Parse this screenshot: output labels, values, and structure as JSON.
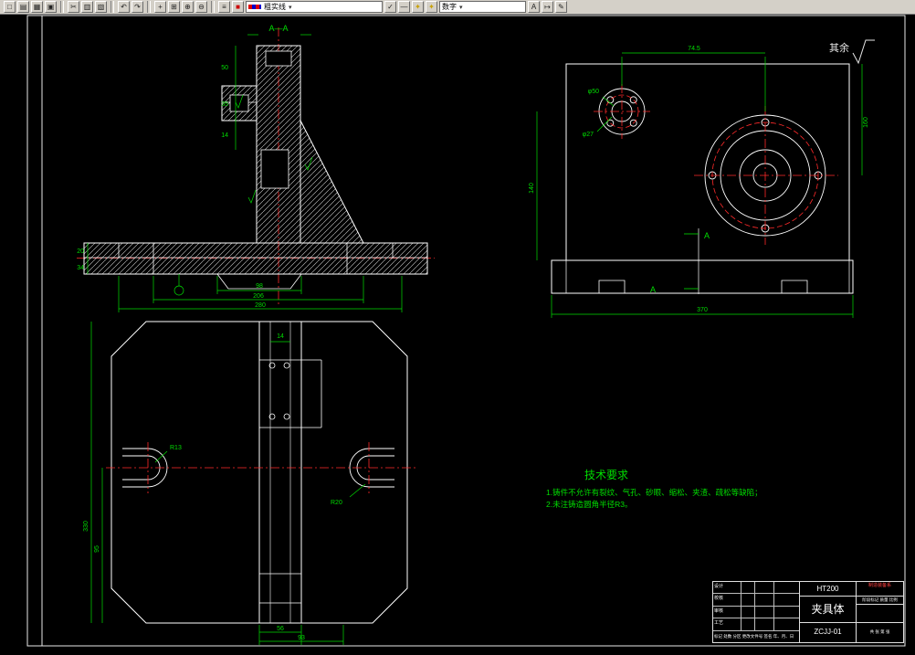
{
  "toolbar": {
    "icons": [
      "□",
      "▤",
      "▦",
      "▣",
      "✂",
      "▥",
      "▧",
      "↶",
      "↷",
      "+",
      "⊞",
      "⊕",
      "⊖",
      "≡",
      "■",
      "✓",
      "—",
      "A",
      "↦",
      "✦",
      "✦",
      "✎"
    ],
    "layer_value": "粗实线",
    "style_value": "数字",
    "arrow": "▾"
  },
  "drawing": {
    "section_label": "A—A",
    "surface_note": "其余",
    "cut_label": "A",
    "tech": {
      "title": "技术要求",
      "line1": "1.铸件不允许有裂纹、气孔、砂眼、缩松、夹渣、疏松等缺陷；",
      "line2": "2.未注铸造圆角半径R3。"
    },
    "dims": {
      "front": {
        "b1": "98",
        "b2": "206",
        "b3": "280",
        "l1": "50",
        "l2": "35",
        "l3": "14",
        "l4": "20",
        "l5": "34"
      },
      "side": {
        "top": "74.5",
        "bottom": "370",
        "right": "160",
        "left": "140",
        "f1": "φ50",
        "f2": "φ27"
      },
      "plan": {
        "r1": "R13",
        "r2": "R20",
        "v1": "330",
        "v2": "95",
        "b1": "56",
        "b2": "93",
        "t1": "14"
      }
    }
  },
  "title_block": {
    "material": "HT200",
    "part_name": "夹具体",
    "drawing_no": "ZCJJ-01",
    "org": "制造装备系",
    "labels": {
      "rev": "标记 处数 分区 更改文件号 签名 年、月、日",
      "stage_row": "阶段标记 质量 比例",
      "sheet": "共 张 第 张"
    },
    "roles": [
      "设计",
      "校核",
      "审核",
      "工艺"
    ]
  }
}
